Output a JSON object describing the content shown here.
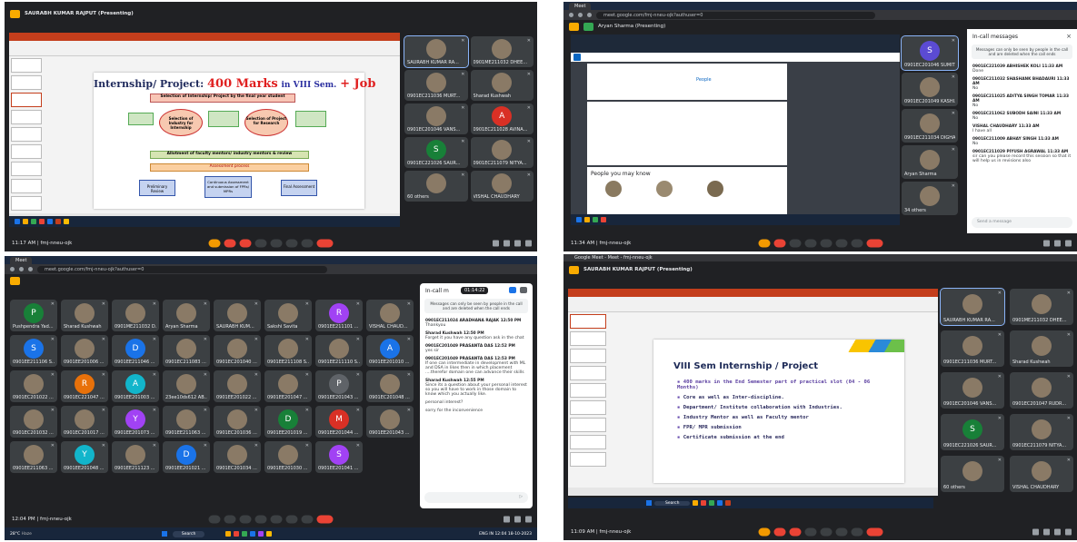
{
  "q1": {
    "presenting": "SAURABH KUMAR RAJPUT (Presenting)",
    "slide": {
      "title_prefix": "Internship/ Project:",
      "title_marks": "400 Marks",
      "title_mid": "in VIII Sem.",
      "title_job": "+ Job",
      "b1": "Selection of Internship/ Project by the final year student",
      "b2": "Selection of Industry for Internship",
      "b3": "Selection of Project for Research",
      "b4": "Allotment of faculty mentors/ industry mentors & review",
      "b5": "Assessment process",
      "c1": "Preliminary Review",
      "c2": "Continuous Assessment and submission of FPRs/ MPRs",
      "c3": "Final Assessment"
    },
    "tiles": [
      {
        "name": "SAURABH KUMAR RA..."
      },
      {
        "name": "0901ME211032 DHEE..."
      },
      {
        "name": "0901EC211036 MURT..."
      },
      {
        "name": "Sharad Kushwah"
      },
      {
        "name": "0901EC201046 VANS..."
      },
      {
        "name": "0901EC211028 AVINA...",
        "initial": "A"
      },
      {
        "name": "0901EC221026 SAUR...",
        "initial": "S"
      },
      {
        "name": "0901EC211079 NITYA..."
      },
      {
        "name": "60 others"
      },
      {
        "name": "VISHAL CHAUDHARY"
      }
    ],
    "time": "11:17 AM",
    "meeting": "fmj-nneu-ojk"
  },
  "q2": {
    "url": "meet.google.com/fmj-nneu-ojk?authuser=0",
    "presenting": "Aryan Sharma (Presenting)",
    "linkedin": {
      "people_heading": "People you may know",
      "tab": "People"
    },
    "tiles": [
      {
        "name": "0901EC201046 SUMIT ...",
        "initial": "S"
      },
      {
        "name": "0901EC201049 KASHI..."
      },
      {
        "name": "0901EC211034 DIGHA..."
      },
      {
        "name": "Aryan Sharma"
      },
      {
        "name": "34 others"
      }
    ],
    "chat": {
      "title": "In-call messages",
      "note": "Messages can only be seen by people in the call and are deleted when the call ends",
      "messages": [
        {
          "from": "0901EC221039 ABHISHEK KOLI 11:33 AM",
          "text": "Done"
        },
        {
          "from": "0901EC211032 SHASHANK BHADAURI 11:33 AM",
          "text": "No"
        },
        {
          "from": "0901EC211025 ADITYA SINGH TOMAR 11:33 AM",
          "text": "No"
        },
        {
          "from": "0901EC211062 SUBODH SAINI 11:33 AM",
          "text": "No"
        },
        {
          "from": "VISHAL CHAUDHARY 11:33 AM",
          "text": "I have all"
        },
        {
          "from": "0901EC211009 ABHAY SINGH 11:33 AM",
          "text": "No"
        },
        {
          "from": "0901EC211029 PIYUSH AGRAWAL 11:33 AM",
          "text": "sir can you please record this session so that it will help us in revisions also"
        }
      ],
      "input_placeholder": "Send a message"
    },
    "time": "11:34 AM",
    "meeting": "fmj-nneu-ojk"
  },
  "q3": {
    "url": "meet.google.com/fmj-nneu-ojk?authuser=0",
    "tiles": [
      {
        "name": "Pushpendra Yad...",
        "initial": "P",
        "color": "#188038"
      },
      {
        "name": "Sharad Kushwah"
      },
      {
        "name": "0901ME211032 D..."
      },
      {
        "name": "Aryan Sharma"
      },
      {
        "name": "SAURABH KUM..."
      },
      {
        "name": "Sakshi Savita"
      },
      {
        "name": "0901EE211101 ...",
        "initial": "R",
        "color": "#a142f4"
      },
      {
        "name": "VISHAL CHAUD..."
      },
      {
        "name": "0901EE211106 S...",
        "initial": "S",
        "color": "#1a73e8"
      },
      {
        "name": "0901EE201006 ..."
      },
      {
        "name": "0901EE211046 ...",
        "initial": "D",
        "color": "#1a73e8"
      },
      {
        "name": "0901EC211083 ..."
      },
      {
        "name": "0901EC201040 ..."
      },
      {
        "name": "0901EE211108 S..."
      },
      {
        "name": "0901EE211110 S..."
      },
      {
        "name": "0901EE201010 ...",
        "initial": "A",
        "color": "#1a73e8"
      },
      {
        "name": "0901EC201022 ..."
      },
      {
        "name": "0901EC221047 ...",
        "initial": "R",
        "color": "#e8710a"
      },
      {
        "name": "0901EE201003 ...",
        "initial": "A",
        "color": "#12b5cb"
      },
      {
        "name": "23ee10ds612 AB..."
      },
      {
        "name": "0901EE201022 ..."
      },
      {
        "name": "0901EE201047 ..."
      },
      {
        "name": "0901EE201043 ...",
        "initial": "P",
        "color": "#5f6368"
      },
      {
        "name": "0901EC201048 ..."
      },
      {
        "name": "0901EC201032 ..."
      },
      {
        "name": "0901EC201017 ..."
      },
      {
        "name": "0901EE201073 ...",
        "initial": "Y",
        "color": "#a142f4"
      },
      {
        "name": "0901EE211063 ..."
      },
      {
        "name": "0901EC201036 ..."
      },
      {
        "name": "0901EE201019 ...",
        "initial": "D",
        "color": "#188038"
      },
      {
        "name": "0901EE201044 ...",
        "initial": "M",
        "color": "#d93025"
      },
      {
        "name": "0901EE201043 ..."
      },
      {
        "name": "0901EE211063 ..."
      },
      {
        "name": "0901EE201048 ...",
        "initial": "Y",
        "color": "#12b5cb"
      },
      {
        "name": "0901EE211123 ..."
      },
      {
        "name": "0901EE201021 ...",
        "initial": "D",
        "color": "#1a73e8"
      },
      {
        "name": "0901EC201034 ..."
      },
      {
        "name": "0901EE201030 ..."
      },
      {
        "name": "0901EE201041 ...",
        "initial": "S",
        "color": "#a142f4"
      }
    ],
    "chat": {
      "title": "In-call m",
      "timer": "01:14:22",
      "note": "Messages can only be seen by people in the call and are deleted when the call ends",
      "messages": [
        {
          "from": "0901EC211024 ARADHANA RAJAK 12:50 PM",
          "text": "Thankyou"
        },
        {
          "from": "Sharad Kushwah 12:50 PM",
          "text": "Forget it you have any question ask in the chat"
        },
        {
          "from": "0901EC201049 PRASANTA DAS 12:52 PM",
          "text": "yes sir"
        },
        {
          "from": "0901EC201049 PRASANTA DAS 12:53 PM",
          "text": "If one can intermediate in development with ML and DSA in likes then in which placement ....therefor domain one can advance their skills"
        },
        {
          "from": "Sharad Kushwah 12:55 PM",
          "text": "Since its a question about your personal interest so you will have to work in those domain to know which you actually like."
        },
        {
          "from": "",
          "text": "personal interest?"
        },
        {
          "from": "",
          "text": "sorry for the inconvenience"
        }
      ]
    },
    "time": "12:04 PM",
    "meeting": "fmj-nneu-ojk",
    "weather": "28°C",
    "weather_sub": "Haze",
    "search": "Search",
    "clock": "12:04",
    "date": "18-10-2023",
    "lang": "ENG IN"
  },
  "q4": {
    "tab": "Google Meet - Meet - fmj-nneu-ojk",
    "presenting": "SAURABH KUMAR RAJPUT (Presenting)",
    "slide": {
      "title": "VIII Sem Internship / Project",
      "bullets": [
        "400 marks in the End Semester part of practical slot (04 - 06 Months)",
        "Core as well as Inter-discipline.",
        "Department/ Institute collaboration with Industries.",
        "Industry Mentor as well as Faculty mentor",
        "FPR/ MPR submission",
        "Certificate submission at the end"
      ]
    },
    "tiles": [
      {
        "name": "SAURABH KUMAR RA..."
      },
      {
        "name": "0901ME211032 DHEE..."
      },
      {
        "name": "0901EC211036 MURT..."
      },
      {
        "name": "Sharad Kushwah"
      },
      {
        "name": "0901EC201046 VANS..."
      },
      {
        "name": "0901EC201047 RUDR..."
      },
      {
        "name": "0901EC221026 SAUR...",
        "initial": "S"
      },
      {
        "name": "0901EC211079 NITYA..."
      },
      {
        "name": "60 others"
      },
      {
        "name": "VISHAL CHAUDHARY"
      }
    ],
    "time": "11:09 AM",
    "meeting": "fmj-nneu-ojk",
    "search": "Search"
  }
}
